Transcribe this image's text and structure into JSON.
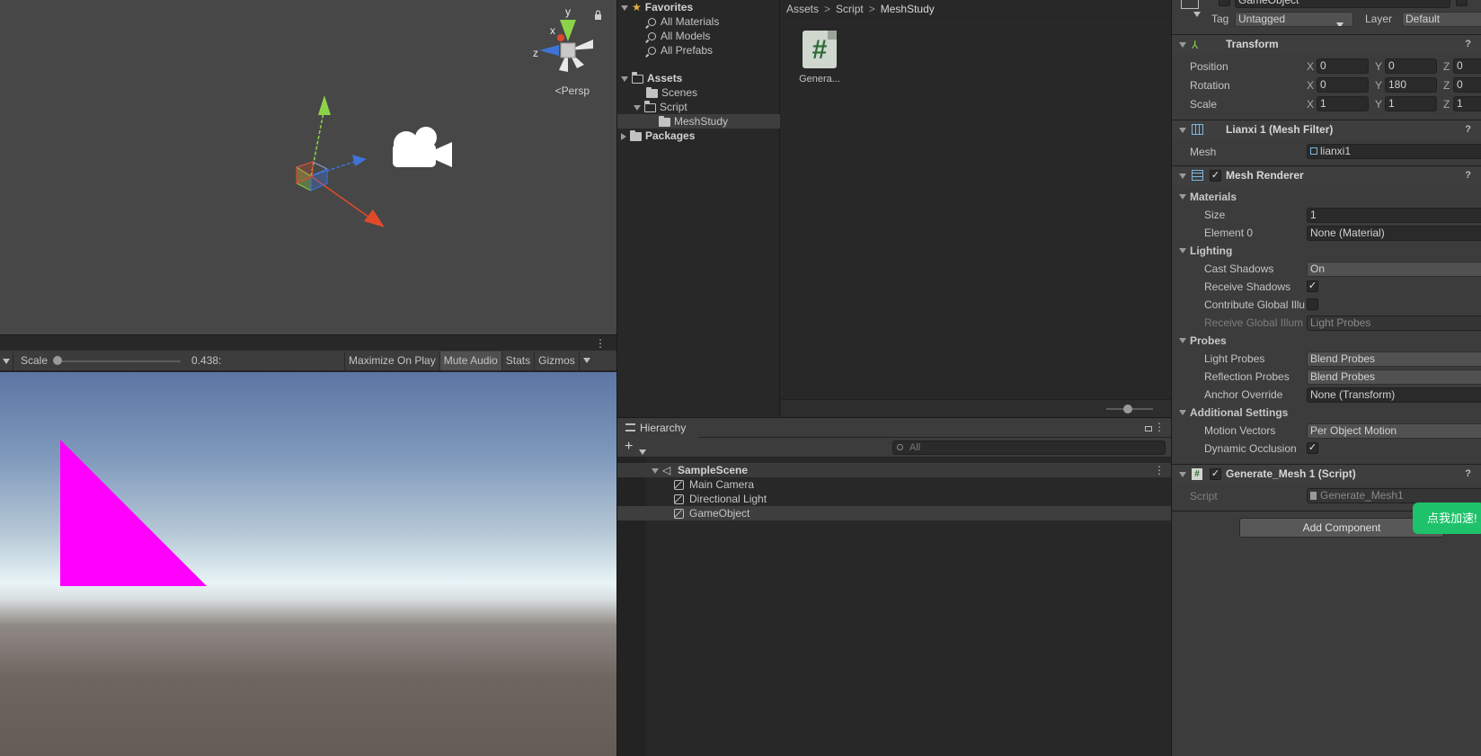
{
  "scene_view": {
    "projection_label": "Persp",
    "gizmo_axes": {
      "x": "x",
      "y": "y",
      "z": "z"
    }
  },
  "game_view": {
    "scale_label": "Scale",
    "scale_value": "0.438",
    "scale_value_display": "0.438:",
    "buttons": [
      "Maximize On Play",
      "Mute Audio",
      "Stats",
      "Gizmos"
    ],
    "triangle_color": "#ff00ff"
  },
  "project": {
    "tree": {
      "favorites_label": "Favorites",
      "favorites": [
        "All Materials",
        "All Models",
        "All Prefabs"
      ],
      "assets_label": "Assets",
      "assets_children": [
        "Scenes",
        "Script"
      ],
      "script_children": [
        "MeshStudy"
      ],
      "packages_label": "Packages"
    },
    "breadcrumb": [
      "Assets",
      "Script",
      "MeshStudy"
    ],
    "files": [
      {
        "name": "Genera...",
        "icon": "csharp-script-icon"
      }
    ]
  },
  "hierarchy": {
    "tab_label": "Hierarchy",
    "search_placeholder": "All",
    "scene_name": "SampleScene",
    "objects": [
      "Main Camera",
      "Directional Light",
      "GameObject"
    ]
  },
  "inspector": {
    "object_name": "GameObject",
    "tag_label": "Tag",
    "tag_value": "Untagged",
    "layer_label": "Layer",
    "layer_value": "Default",
    "transform": {
      "title": "Transform",
      "position_label": "Position",
      "rotation_label": "Rotation",
      "scale_label": "Scale",
      "position": {
        "x": "0",
        "y": "0",
        "z": "0"
      },
      "rotation": {
        "x": "0",
        "y": "180",
        "z": "0"
      },
      "scale": {
        "x": "1",
        "y": "1",
        "z": "1"
      }
    },
    "mesh_filter": {
      "title": "Lianxi 1 (Mesh Filter)",
      "mesh_label": "Mesh",
      "mesh_value": "lianxi1"
    },
    "mesh_renderer": {
      "title": "Mesh Renderer",
      "materials_label": "Materials",
      "size_label": "Size",
      "size_value": "1",
      "element0_label": "Element 0",
      "element0_value": "None (Material)",
      "lighting_label": "Lighting",
      "cast_shadows_label": "Cast Shadows",
      "cast_shadows_value": "On",
      "receive_shadows_label": "Receive Shadows",
      "contribute_gi_label": "Contribute Global Illu",
      "receive_gi_label": "Receive Global Illum",
      "receive_gi_value": "Light Probes",
      "probes_label": "Probes",
      "light_probes_label": "Light Probes",
      "light_probes_value": "Blend Probes",
      "reflection_probes_label": "Reflection Probes",
      "reflection_probes_value": "Blend Probes",
      "anchor_override_label": "Anchor Override",
      "anchor_override_value": "None (Transform)",
      "additional_label": "Additional Settings",
      "motion_vectors_label": "Motion Vectors",
      "motion_vectors_value": "Per Object Motion",
      "dynamic_occlusion_label": "Dynamic Occlusion"
    },
    "script_comp": {
      "title": "Generate_Mesh 1 (Script)",
      "script_label": "Script",
      "script_value": "Generate_Mesh1"
    },
    "add_component_label": "Add Component",
    "help_glyph": "?"
  },
  "overlay": {
    "speedup_label": "点我加速!",
    "speedup_color": "#1ec26a"
  }
}
